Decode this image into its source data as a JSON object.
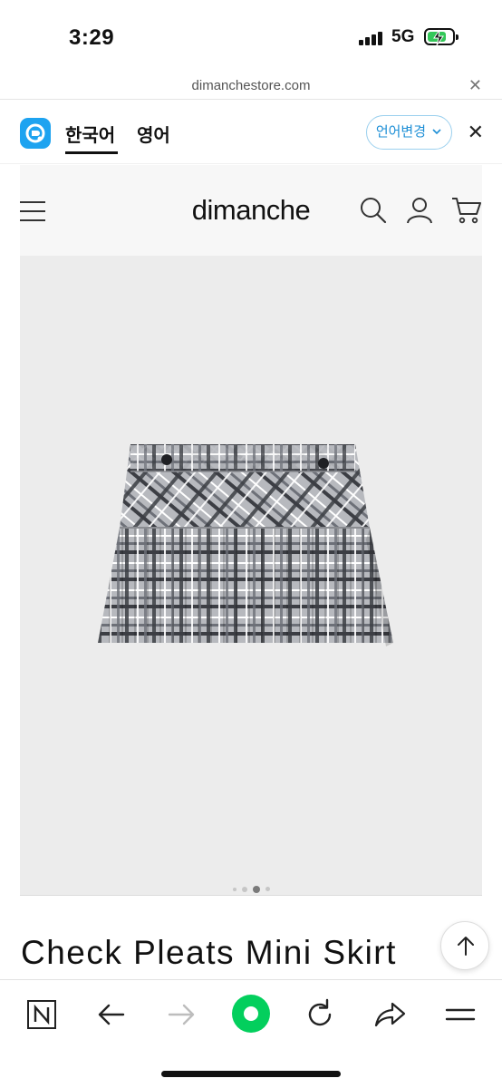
{
  "status_bar": {
    "time": "3:29",
    "network": "5G",
    "battery_charging": true
  },
  "url_bar": {
    "url": "dimanchestore.com",
    "close_icon": "close-icon"
  },
  "translate_bar": {
    "tabs": [
      {
        "label": "한국어",
        "selected": true
      },
      {
        "label": "영어",
        "selected": false
      }
    ],
    "change_language_label": "언어변경",
    "app_icon": "papago-icon",
    "accent_color": "#1ea3f0"
  },
  "site_header": {
    "brand": "dimanche",
    "icons": [
      "menu-icon",
      "search-icon",
      "user-icon",
      "cart-icon"
    ]
  },
  "product": {
    "title": "Check Pleats Mini Skirt",
    "image_icon": "plaid-skirt-image",
    "carousel": {
      "count": 4,
      "active_index": 2
    }
  },
  "bottom_toolbar": {
    "buttons": [
      "naver-home-icon",
      "back-icon",
      "forward-icon",
      "green-dot-icon",
      "reload-icon",
      "share-icon",
      "menu-icon"
    ],
    "green_color": "#03cf5d"
  }
}
